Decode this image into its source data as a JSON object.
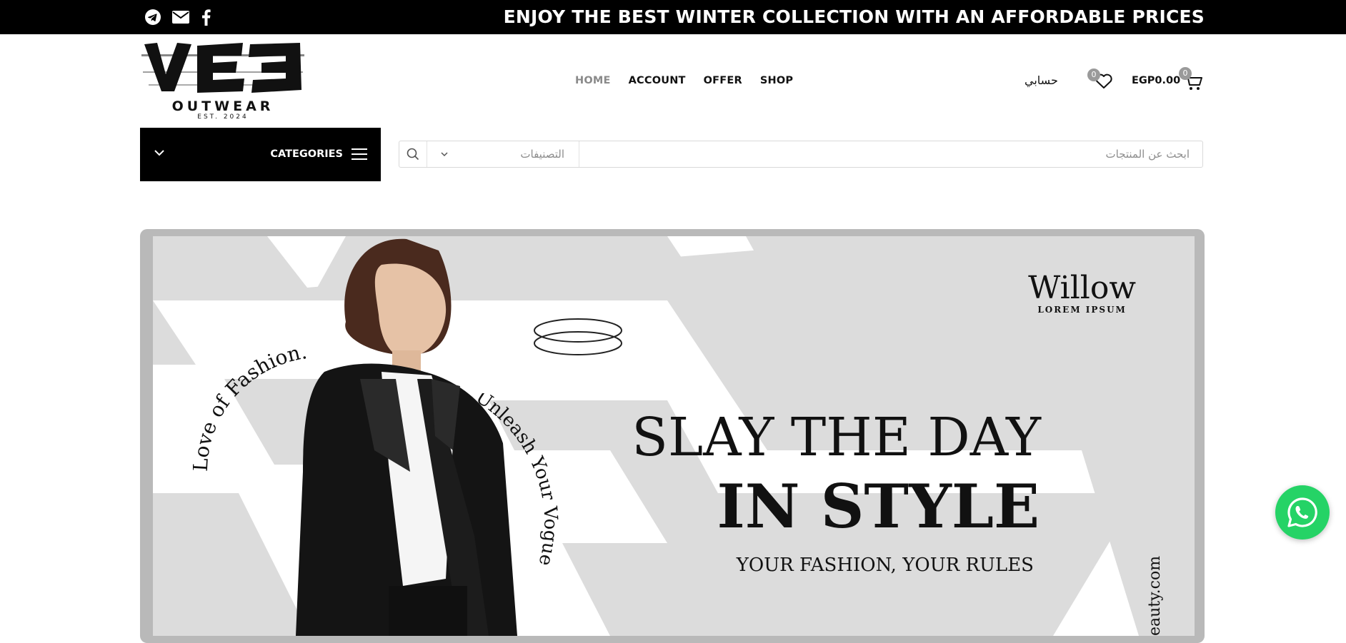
{
  "topbar": {
    "social": [
      {
        "icon": "telegram-icon"
      },
      {
        "icon": "email-icon"
      },
      {
        "icon": "facebook-icon"
      }
    ],
    "announcement": "ENJOY THE BEST WINTER COLLECTION WITH AN AFFORDABLE PRICES"
  },
  "logo": {
    "wordmark": "OUTWEAR",
    "est": "EST. 2024"
  },
  "nav": {
    "items": [
      {
        "label": "HOME",
        "active": true
      },
      {
        "label": "ACCOUNT",
        "active": false
      },
      {
        "label": "OFFER",
        "active": false
      },
      {
        "label": "SHOP",
        "active": false
      }
    ]
  },
  "header_right": {
    "account_label": "حسابي",
    "wishlist_count": "0",
    "cart_total": "EGP0.00",
    "cart_count": "0"
  },
  "categories": {
    "label": "CATEGORIES"
  },
  "search": {
    "category_placeholder": "التصنيفات",
    "placeholder": "ابحث عن المنتجات"
  },
  "hero": {
    "brand_name": "Willow",
    "brand_sub": "LOREM IPSUM",
    "headline": "SLAY THE DAY",
    "headline_bold": "IN STYLE",
    "tagline": "YOUR FASHION, YOUR RULES",
    "curve_text_left": "Love of Fashion.",
    "curve_text_right": "Unleash Your Vogue",
    "url_partial": "eauty.com"
  },
  "colors": {
    "topbar_bg": "#000000",
    "nav_active": "#8a8a8a",
    "badge": "#9a9a9a",
    "whatsapp": "#25d366"
  }
}
